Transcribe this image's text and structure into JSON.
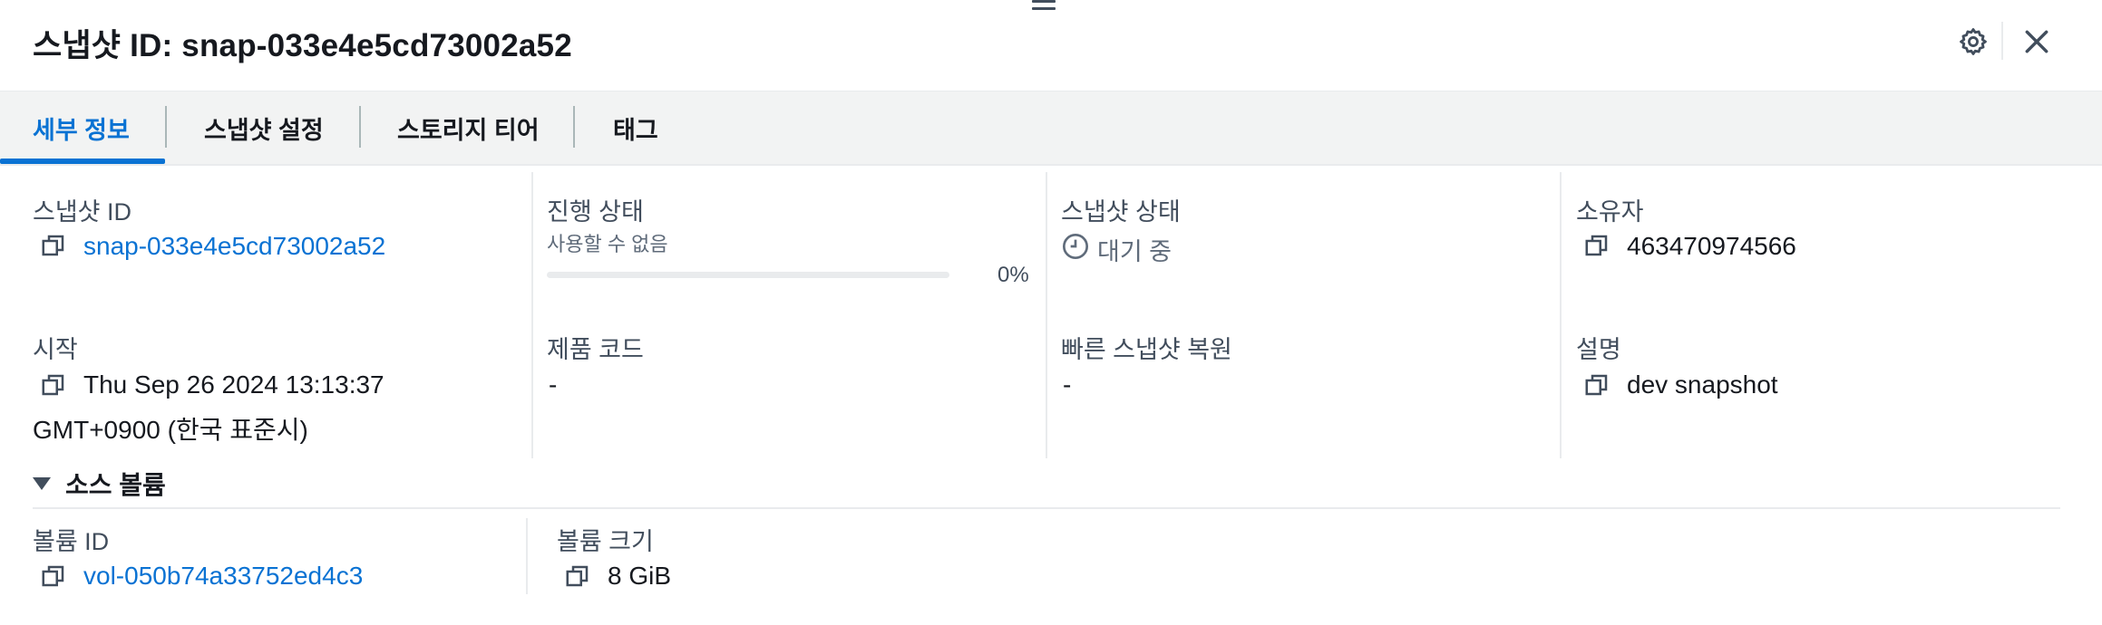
{
  "header": {
    "title": "스냅샷 ID: snap-033e4e5cd73002a52",
    "settings_icon": "gear-icon",
    "close_icon": "close-icon"
  },
  "tabs": [
    {
      "label": "세부 정보",
      "active": true
    },
    {
      "label": "스냅샷 설정",
      "active": false
    },
    {
      "label": "스토리지 티어",
      "active": false
    },
    {
      "label": "태그",
      "active": false
    }
  ],
  "details": {
    "snapshot_id": {
      "label": "스냅샷 ID",
      "value": "snap-033e4e5cd73002a52"
    },
    "progress": {
      "label": "진행 상태",
      "sublabel": "사용할 수 없음",
      "percent_text": "0%",
      "percent": 0
    },
    "snapshot_status": {
      "label": "스냅샷 상태",
      "value": "대기 중",
      "icon": "clock-icon"
    },
    "owner": {
      "label": "소유자",
      "value": "463470974566"
    },
    "started": {
      "label": "시작",
      "value_line1": "Thu Sep 26 2024 13:13:37",
      "value_line2": "GMT+0900 (한국 표준시)"
    },
    "product_code": {
      "label": "제품 코드",
      "value": "-"
    },
    "fast_restore": {
      "label": "빠른 스냅샷 복원",
      "value": "-"
    },
    "description": {
      "label": "설명",
      "value": "dev snapshot"
    }
  },
  "source_volume": {
    "section_title": "소스 볼륨",
    "volume_id": {
      "label": "볼륨 ID",
      "value": "vol-050b74a33752ed4c3"
    },
    "volume_size": {
      "label": "볼륨 크기",
      "value": "8 GiB"
    }
  },
  "colors": {
    "accent": "#0972d3",
    "text": "#16191f",
    "muted": "#5f6b7a",
    "border": "#e9ebed"
  }
}
